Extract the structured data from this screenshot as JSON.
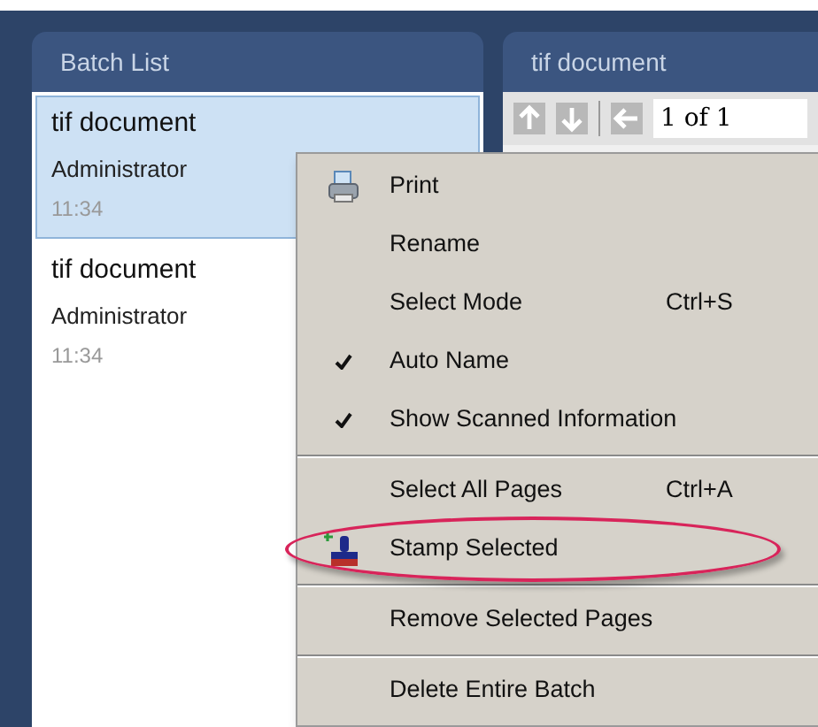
{
  "batch_list": {
    "title": "Batch List",
    "items": [
      {
        "name": "tif document",
        "user": "Administrator",
        "time": "11:34",
        "selected": true
      },
      {
        "name": "tif document",
        "user": "Administrator",
        "time": "11:34",
        "selected": false
      }
    ]
  },
  "viewer": {
    "title": "tif document",
    "page_field": "1 of 1"
  },
  "context_menu": {
    "groups": [
      [
        {
          "label": "Print",
          "kind": "printer",
          "checked": false
        },
        {
          "label": "Rename",
          "checked": false
        },
        {
          "label": "Select Mode",
          "shortcut": "Ctrl+S",
          "checked": false
        },
        {
          "label": "Auto Name",
          "checked": true
        },
        {
          "label": "Show Scanned Information",
          "checked": true
        }
      ],
      [
        {
          "label": "Select All Pages",
          "shortcut": "Ctrl+A",
          "checked": false
        },
        {
          "label": "Stamp Selected",
          "kind": "stamp",
          "checked": false,
          "highlighted": true
        }
      ],
      [
        {
          "label": "Remove Selected Pages",
          "checked": false
        }
      ],
      [
        {
          "label": "Delete Entire Batch",
          "checked": false
        }
      ]
    ]
  }
}
